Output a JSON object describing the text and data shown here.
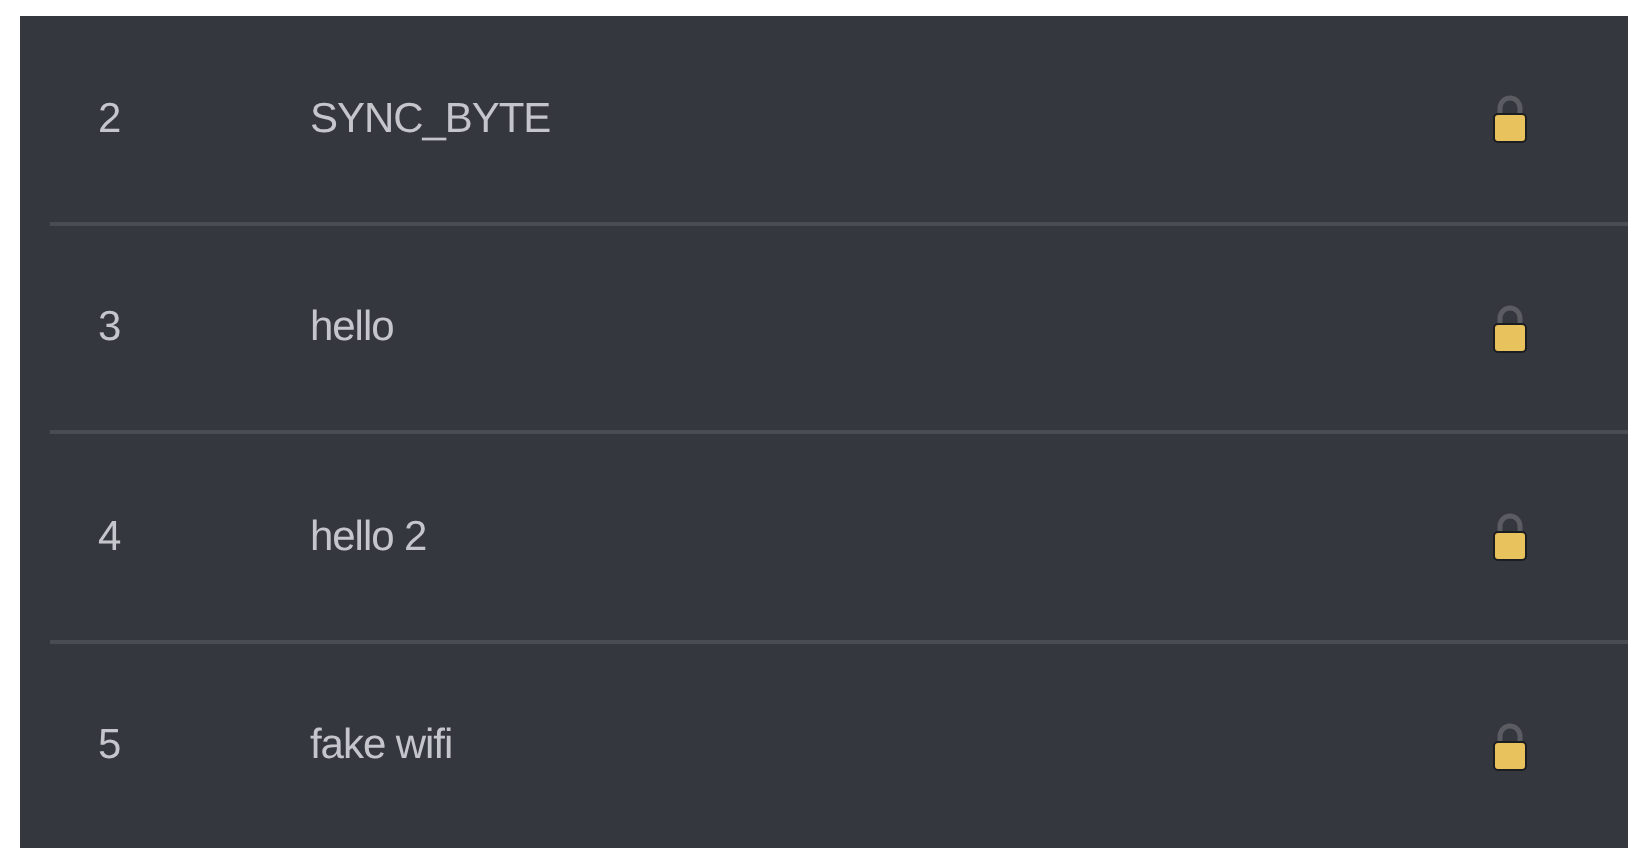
{
  "networks": [
    {
      "number": "2",
      "name": "SYNC_BYTE",
      "locked": true
    },
    {
      "number": "3",
      "name": "hello",
      "locked": true
    },
    {
      "number": "4",
      "name": "hello 2",
      "locked": true
    },
    {
      "number": "5",
      "name": "fake wifi",
      "locked": true
    }
  ]
}
